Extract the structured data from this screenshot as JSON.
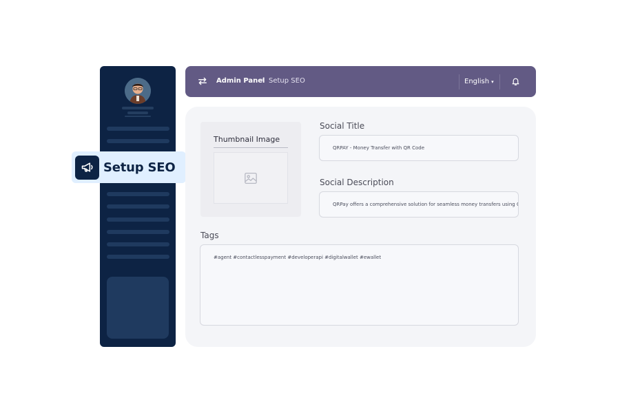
{
  "floating_item": {
    "label": "Setup SEO",
    "icon": "megaphone-icon"
  },
  "topbar": {
    "breadcrumb_home": "Admin Panel",
    "breadcrumb_separator": "›",
    "breadcrumb_current": "Setup SEO",
    "language": "English",
    "caret": "▾"
  },
  "form": {
    "thumbnail_label": "Thumbnail Image",
    "social_title_label": "Social Title",
    "social_title_value": "QRPAY - Money Transfer with QR Code",
    "social_description_label": "Social Description",
    "social_description_value": "QRPay offers a comprehensive solution for seamless money transfers using Q...",
    "tags_label": "Tags",
    "tags_value": "#agent #contactlesspayment #developerapi #digitalwallet #ewallet"
  },
  "colors": {
    "sidebar": "#0d2344",
    "topbar": "#625a84",
    "highlight": "#e0efff",
    "panel": "#f4f5f8"
  }
}
